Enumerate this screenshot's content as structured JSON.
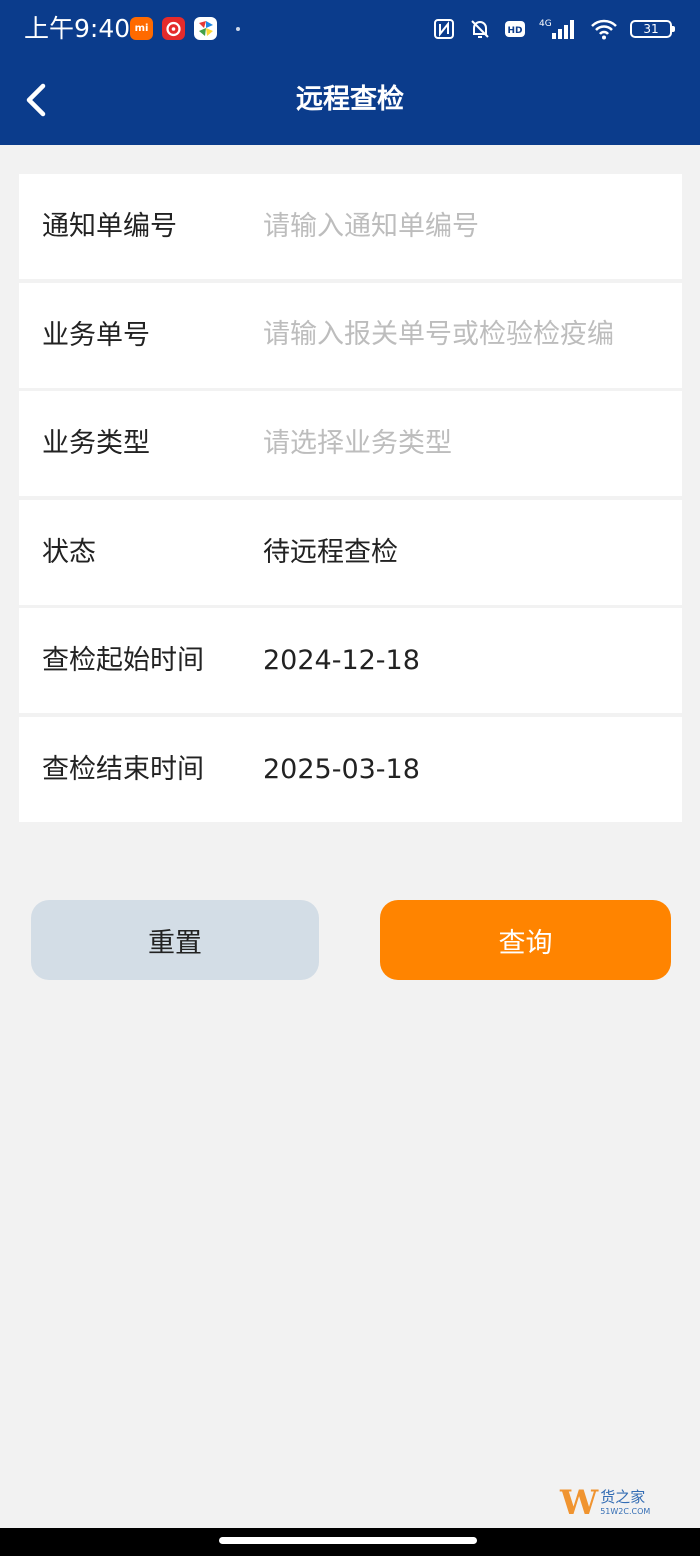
{
  "status_bar": {
    "time": "上午9:40",
    "battery": "31"
  },
  "nav": {
    "title": "远程查检"
  },
  "form": {
    "rows": [
      {
        "label": "通知单编号",
        "placeholder": "请输入通知单编号",
        "value": ""
      },
      {
        "label": "业务单号",
        "placeholder": "请输入报关单号或检验检疫编",
        "value": ""
      },
      {
        "label": "业务类型",
        "placeholder": "请选择业务类型",
        "value": ""
      },
      {
        "label": "状态",
        "value": "待远程查检"
      },
      {
        "label": "查检起始时间",
        "value": "2024-12-18"
      },
      {
        "label": "查检结束时间",
        "value": "2025-03-18"
      }
    ]
  },
  "buttons": {
    "reset": "重置",
    "query": "查询"
  },
  "watermark": {
    "main": "货之家",
    "sub": "51W2C.COM"
  },
  "colors": {
    "header": "#0b3c8c",
    "query_button": "#ff8400",
    "reset_button": "#d3dde6",
    "background": "#f2f2f2"
  }
}
